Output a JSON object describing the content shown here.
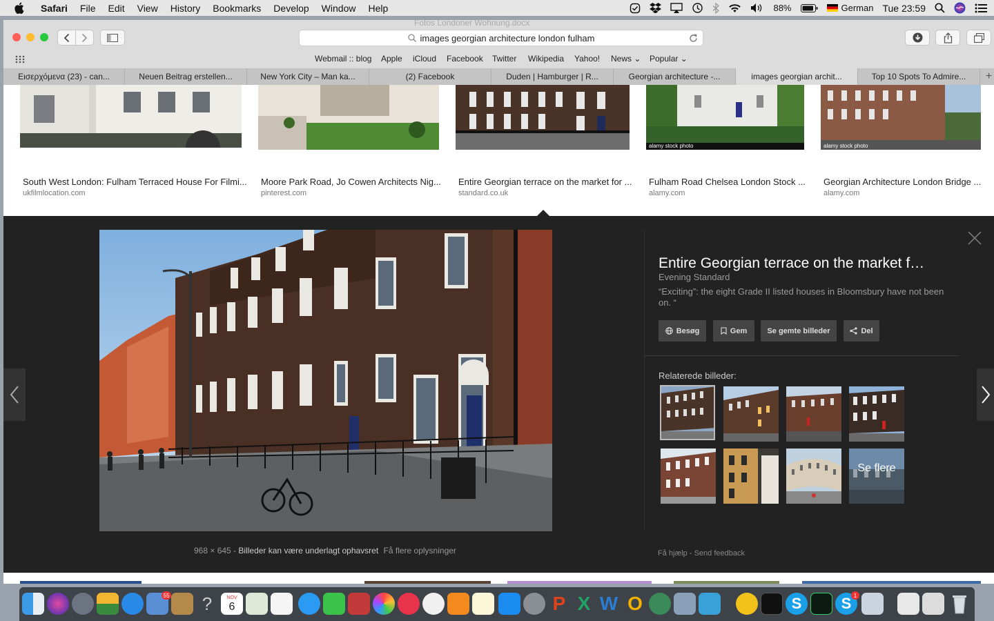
{
  "menubar": {
    "app_name": "Safari",
    "items": [
      "File",
      "Edit",
      "View",
      "History",
      "Bookmarks",
      "Develop",
      "Window",
      "Help"
    ],
    "battery": "88%",
    "input_language": "German",
    "clock": "Tue 23:59"
  },
  "browser": {
    "window_title": "Fotos Londoner Wohnung.docx",
    "address": "images georgian architecture london fulham",
    "favorites": [
      "Webmail :: blog",
      "Apple",
      "iCloud",
      "Facebook",
      "Twitter",
      "Wikipedia",
      "Yahoo!",
      "News",
      "Popular"
    ],
    "tabs": [
      {
        "label": "Εισερχόμενα (23) - can..."
      },
      {
        "label": "Neuen Beitrag erstellen..."
      },
      {
        "label": "New York City – Man ka..."
      },
      {
        "label": "(2) Facebook"
      },
      {
        "label": "Duden | Hamburger | R..."
      },
      {
        "label": "Georgian architecture -..."
      },
      {
        "label": "images georgian archit..."
      },
      {
        "label": "Top 10 Spots To Admire..."
      }
    ]
  },
  "results": [
    {
      "caption": "South West London: Fulham Terraced House For Filmi...",
      "source": "ukfilmlocation.com"
    },
    {
      "caption": "Moore Park Road, Jo Cowen Architects Nig...",
      "source": "pinterest.com"
    },
    {
      "caption": "Entire Georgian terrace on the market for ...",
      "source": "standard.co.uk"
    },
    {
      "caption": "Fulham Road Chelsea London Stock ...",
      "source": "alamy.com",
      "watermark": "alamy stock photo"
    },
    {
      "caption": "Georgian Architecture London Bridge ...",
      "source": "alamy.com",
      "watermark": "alamy stock photo"
    }
  ],
  "viewer": {
    "dimensions": "968 × 645",
    "copyright_note": "Billeder kan være underlagt ophavsret",
    "more_info": "Få flere oplysninger",
    "title": "Entire Georgian terrace on the market f…",
    "source": "Evening Standard",
    "description": "“Exciting”: the eight Grade II listed houses in Bloomsbury have not been on. “",
    "buttons": {
      "visit": "Besøg",
      "save": "Gem",
      "saved": "Se gemte billeder",
      "share": "Del"
    },
    "related_label": "Relaterede billeder:",
    "see_more": "Se flere",
    "help": "Få hjælp",
    "feedback": "Send feedback"
  },
  "dock": {
    "calendar_month": "NOV",
    "calendar_day": "6",
    "badge_mail": "55",
    "badge_skype": "1"
  },
  "colors": {
    "viewer_bg": "#222222",
    "accent_blue": "#2a6fd6",
    "close_red": "#fe5f57",
    "min_yellow": "#febc2e",
    "zoom_green": "#28c840"
  }
}
